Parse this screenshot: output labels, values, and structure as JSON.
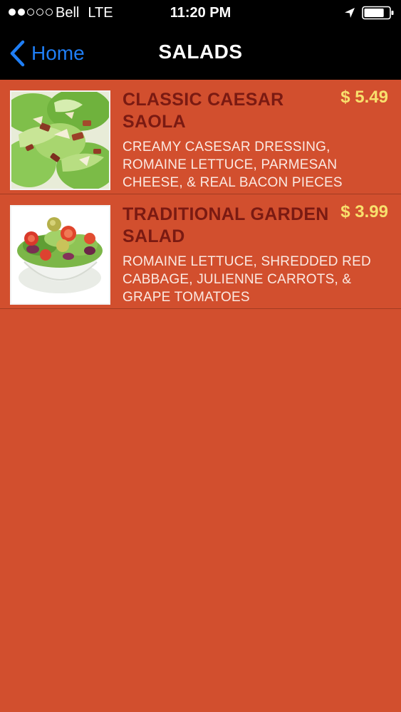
{
  "status_bar": {
    "carrier": "Bell",
    "network": "LTE",
    "time": "11:20 PM",
    "signal_bars_filled": 2,
    "signal_bars_total": 5,
    "battery_level": 0.8
  },
  "nav": {
    "back_label": "Home",
    "title": "SALADS"
  },
  "colors": {
    "background": "#d24f2e",
    "item_name": "#7a1a12",
    "price": "#f8e06d",
    "description": "#fbe9e2",
    "back_link": "#1f7ef5"
  },
  "menu": {
    "items": [
      {
        "name": "CLASSIC CAESAR SAOLA",
        "price": "$ 5.49",
        "description": "CREAMY CASESAR DRESSING, ROMAINE LETTUCE, PARMESAN CHEESE, & REAL BACON PIECES",
        "image": "caesar-salad-photo"
      },
      {
        "name": "TRADITIONAL GARDEN SALAD",
        "price": "$ 3.99",
        "description": "ROMAINE LETTUCE, SHREDDED RED CABBAGE, JULIENNE CARROTS, & GRAPE TOMATOES",
        "image": "garden-salad-photo"
      }
    ]
  }
}
